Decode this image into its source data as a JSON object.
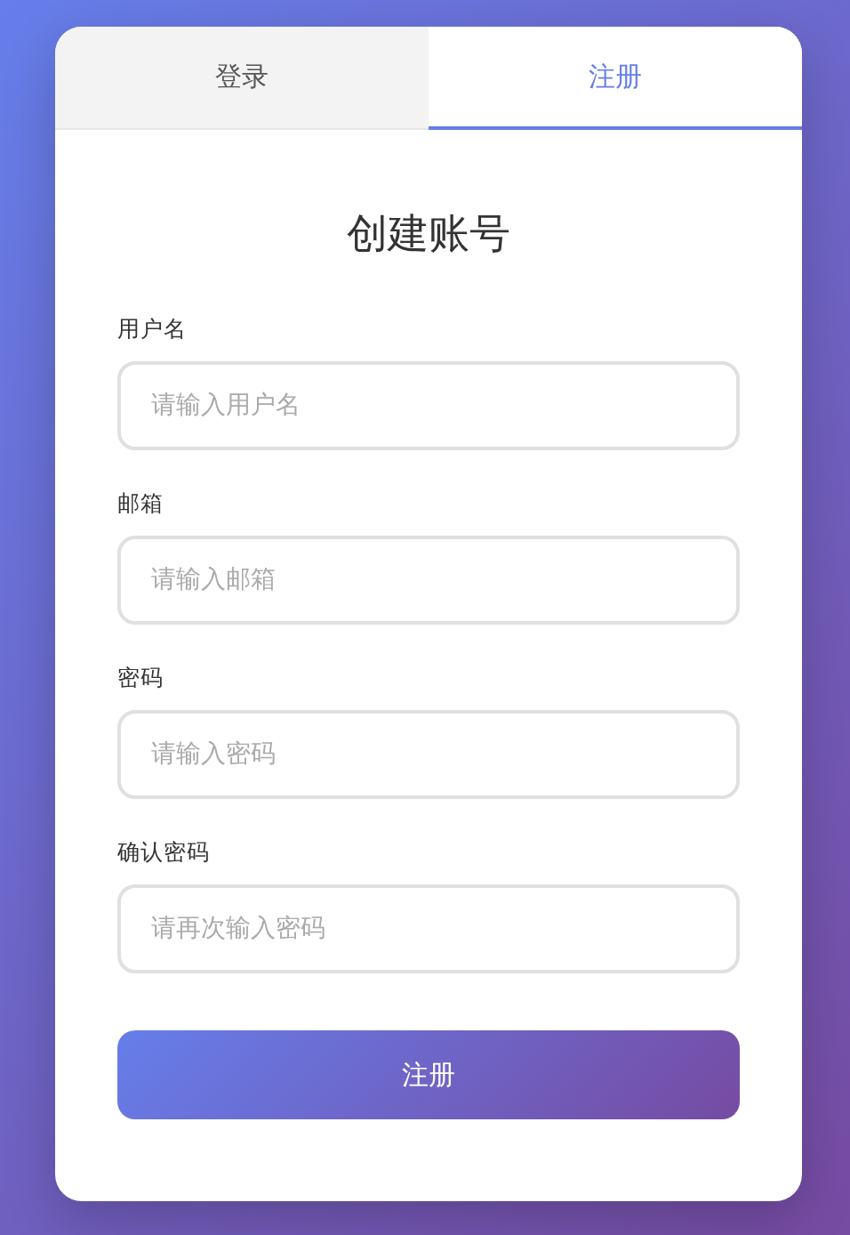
{
  "tabs": [
    {
      "label": "登录",
      "selected": false
    },
    {
      "label": "注册",
      "selected": true
    }
  ],
  "form": {
    "title": "创建账号",
    "fields": [
      {
        "label": "用户名",
        "placeholder": "请输入用户名"
      },
      {
        "label": "邮箱",
        "placeholder": "请输入邮箱"
      },
      {
        "label": "密码",
        "placeholder": "请输入密码"
      },
      {
        "label": "确认密码",
        "placeholder": "请再次输入密码"
      }
    ],
    "submit": "注册"
  }
}
